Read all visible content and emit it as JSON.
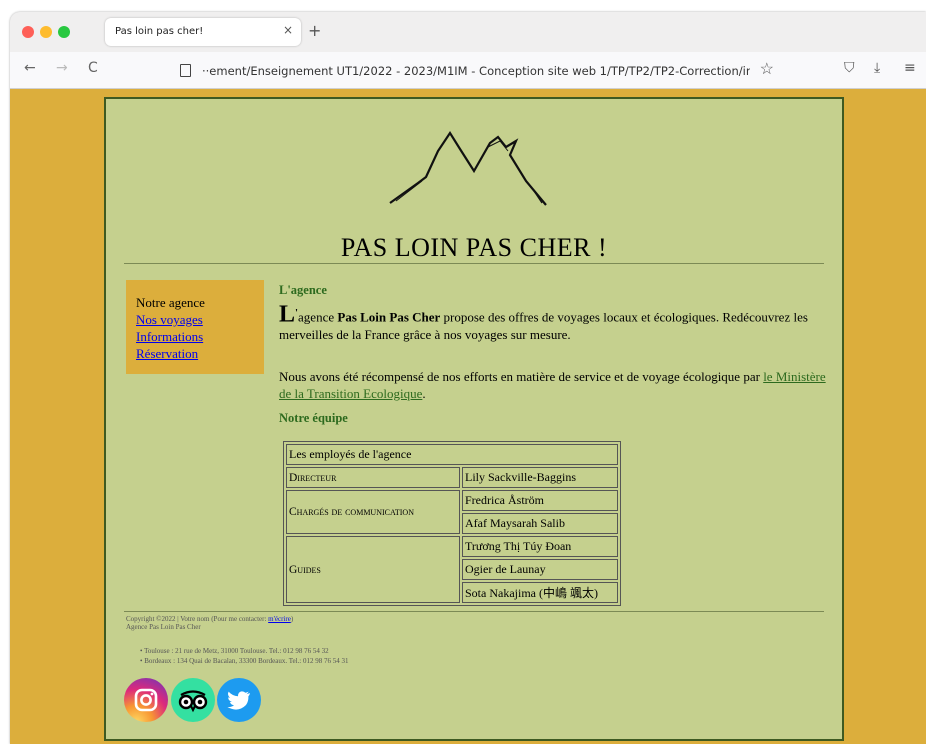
{
  "browser": {
    "tab_title": "Pas loin pas cher!",
    "tab_close": "×",
    "new_tab": "+",
    "nav_back": "←",
    "nav_forward": "→",
    "nav_reload": "C",
    "url": "··ement/Enseignement UT1/2022 - 2023/M1IM - Conception site web 1/TP/TP2/TP2-Correction/in",
    "bookmark_icon": "☆",
    "pocket_icon": "⛉",
    "download_icon": "⤓",
    "menu_icon": "≡"
  },
  "page": {
    "title": "PAS LOIN PAS CHER !",
    "sidebar": {
      "items": [
        "Notre agence",
        "Nos voyages",
        "Informations",
        "Réservation"
      ]
    },
    "agence_heading": "L'agence",
    "p1": {
      "dropcap": "L",
      "apostrophe": "'",
      "before": "agence ",
      "bold": "Pas Loin Pas Cher",
      "after": " propose des offres de voyages locaux et écologiques. Redécouvrez les merveilles de la France grâce à nos voyages sur mesure."
    },
    "p2": {
      "text": "Nous avons été récompensé de nos efforts en matière de service et de voyage écologique par ",
      "link": "le Ministère de la Transition Ecologique",
      "end": "."
    },
    "equipe_heading": "Notre équipe",
    "table": {
      "caption": "Les employés de l'agence",
      "roles": [
        "Directeur",
        "Chargés de communication",
        "Guides"
      ],
      "directeur": "Lily Sackville-Baggins",
      "communication": [
        "Fredrica Åström",
        "Afaf Maysarah Salib"
      ],
      "guides": [
        "Trương Thị Túy Đoan",
        "Ogier de Launay",
        "Sota Nakajima (中嶋 颯太)"
      ]
    },
    "footer": {
      "copyright_prefix": "Copyright ©2022 | Votre nom (Pour me contacter: ",
      "contact_link": "m'écrire",
      "copyright_suffix": ")",
      "agency": "Agence Pas Loin Pas Cher",
      "addresses": [
        "Toulouse : 21 rue de Metz, 31000 Toulouse. Tel.: 012 98 76 54 32",
        "Bordeaux : 134 Quai de Bacalan, 33300 Bordeaux. Tel.: 012 98 76 54 31"
      ]
    },
    "social_icons": [
      "instagram-icon",
      "tripadvisor-icon",
      "twitter-icon"
    ]
  },
  "colors": {
    "page_background": "#dcae3c",
    "content_background": "#c5d08e",
    "heading_green": "#2d6a1e",
    "link_blue": "#0000ee"
  }
}
